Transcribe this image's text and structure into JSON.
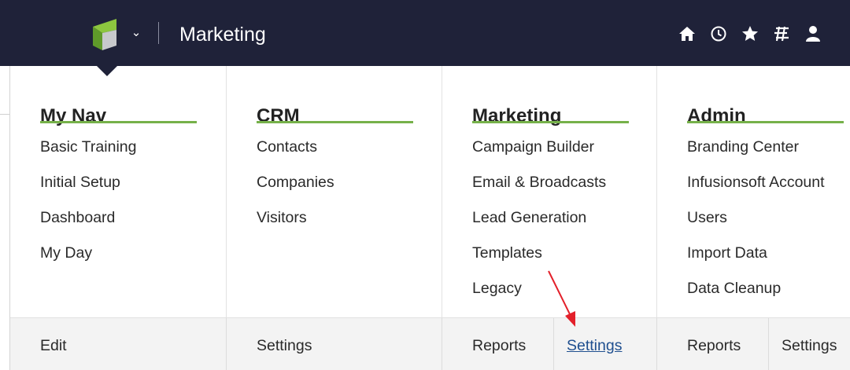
{
  "header": {
    "app_title": "Marketing",
    "icons": [
      "home-icon",
      "clock-icon",
      "star-icon",
      "grid-icon",
      "user-icon"
    ]
  },
  "colors": {
    "topbar_bg": "#1f2239",
    "accent_green": "#76b14a",
    "link_blue": "#1f4f8f",
    "arrow_red": "#e3202a"
  },
  "menu": {
    "columns": [
      {
        "title": "My Nav",
        "items": [
          "Basic Training",
          "Initial Setup",
          "Dashboard",
          "My Day"
        ]
      },
      {
        "title": "CRM",
        "items": [
          "Contacts",
          "Companies",
          "Visitors"
        ]
      },
      {
        "title": "Marketing",
        "items": [
          "Campaign Builder",
          "Email & Broadcasts",
          "Lead Generation",
          "Templates",
          "Legacy"
        ]
      },
      {
        "title": "Admin",
        "items": [
          "Branding Center",
          "Infusionsoft Account",
          "Users",
          "Import Data",
          "Data Cleanup"
        ]
      }
    ],
    "footer": {
      "mynav_edit": "Edit",
      "crm_settings": "Settings",
      "marketing_reports": "Reports",
      "marketing_settings": "Settings",
      "admin_reports": "Reports",
      "admin_settings": "Settings",
      "active_link": "marketing_settings"
    }
  }
}
